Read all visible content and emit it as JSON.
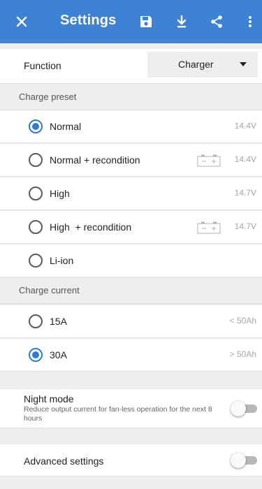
{
  "app_bar": {
    "title": "Settings",
    "background": "#3d82d5",
    "icons": [
      "close-icon",
      "save-icon",
      "download-icon",
      "share-icon",
      "more-vert-icon"
    ]
  },
  "function_setting": {
    "label": "Function",
    "selected": "Charger"
  },
  "charge_preset": {
    "header": "Charge preset",
    "options": [
      {
        "label": "Normal",
        "value": "14.4V",
        "selected": true,
        "battery_icon": false
      },
      {
        "label": "Normal + recondition",
        "value": "14.4V",
        "selected": false,
        "battery_icon": true
      },
      {
        "label": "High",
        "value": "14.7V",
        "selected": false,
        "battery_icon": false
      },
      {
        "label": "High  + recondition",
        "value": "14.7V",
        "selected": false,
        "battery_icon": true
      },
      {
        "label": "Li-ion",
        "value": "",
        "selected": false,
        "battery_icon": false
      }
    ]
  },
  "charge_current": {
    "header": "Charge current",
    "options": [
      {
        "label": "15A",
        "value": "< 50Ah",
        "selected": false
      },
      {
        "label": "30A",
        "value": "> 50Ah",
        "selected": true
      }
    ]
  },
  "night_mode": {
    "title": "Night mode",
    "description": "Reduce output current for fan-less operation for the next 8 hours",
    "enabled": false
  },
  "advanced_settings": {
    "title": "Advanced settings",
    "enabled": false
  },
  "colors": {
    "accent": "#2f7ad6",
    "value_text": "#a8a8a8"
  }
}
